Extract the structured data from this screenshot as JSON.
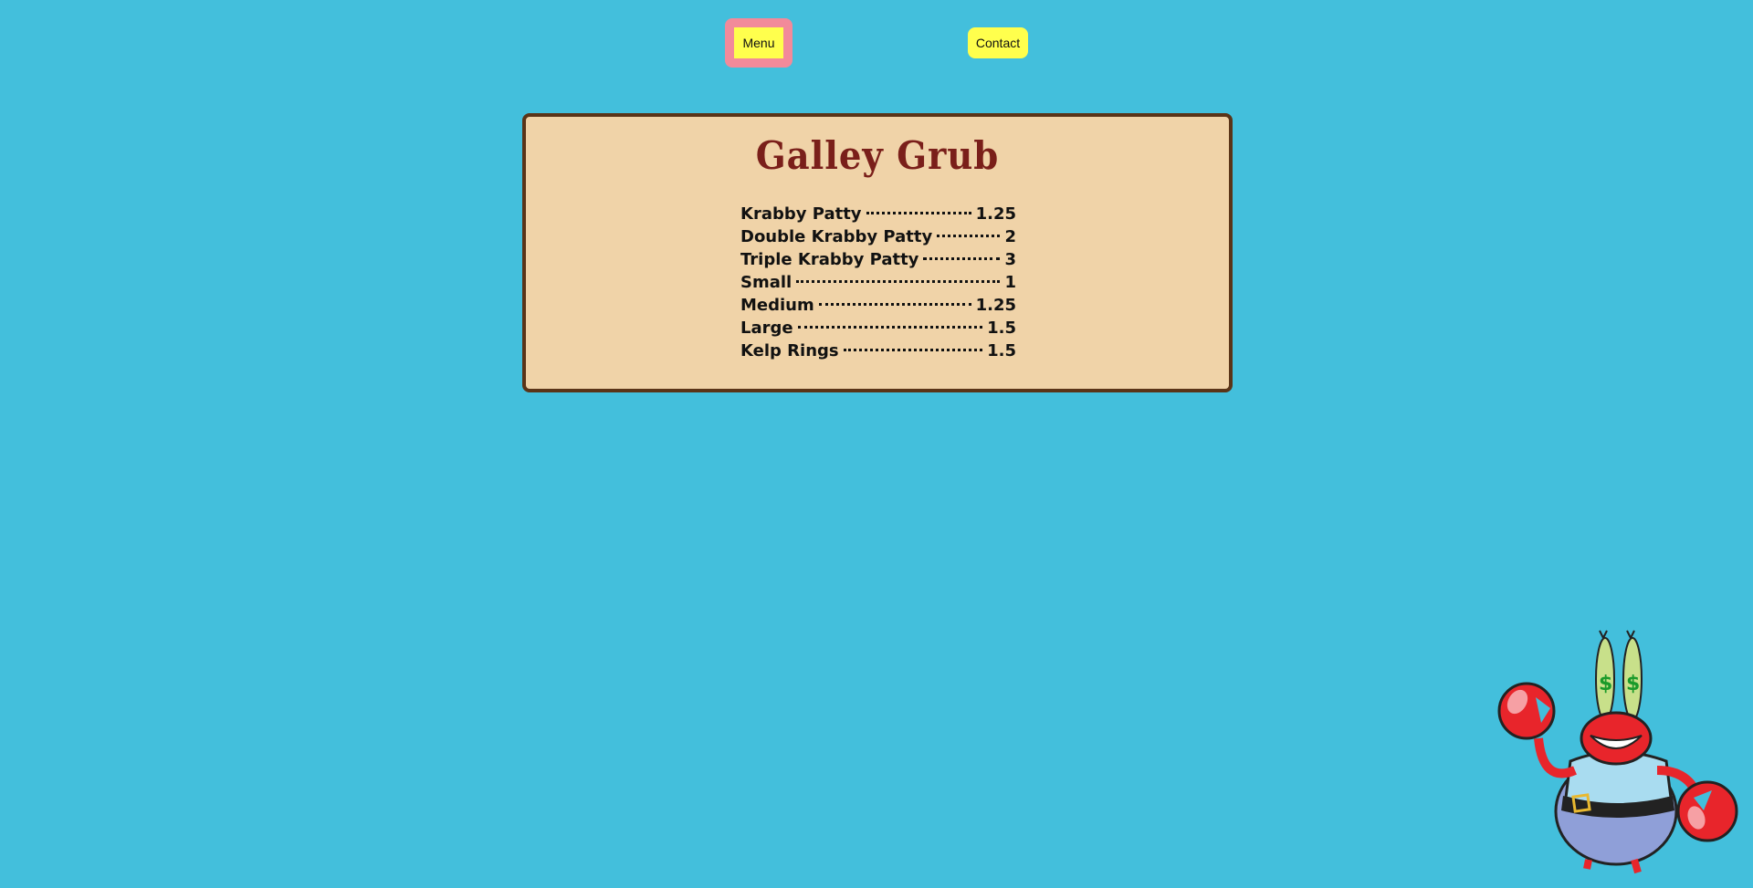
{
  "nav": {
    "menu_label": "Menu",
    "contact_label": "Contact"
  },
  "board": {
    "title": "Galley Grub",
    "items": [
      {
        "name": "Krabby Patty",
        "price": "1.25"
      },
      {
        "name": "Double Krabby Patty",
        "price": "2"
      },
      {
        "name": "Triple Krabby Patty",
        "price": "3"
      },
      {
        "name": "Small",
        "price": "1"
      },
      {
        "name": "Medium",
        "price": "1.25"
      },
      {
        "name": "Large",
        "price": "1.5"
      },
      {
        "name": "Kelp Rings",
        "price": "1.5"
      }
    ]
  },
  "colors": {
    "background": "#43bfdc",
    "button": "#ffff4d",
    "active_button_frame": "#f28a9a",
    "board": "#f0d3a8",
    "board_border": "#5a3418",
    "title": "#7a1f1a"
  },
  "mascot": {
    "icon": "crab-mascot-icon"
  }
}
